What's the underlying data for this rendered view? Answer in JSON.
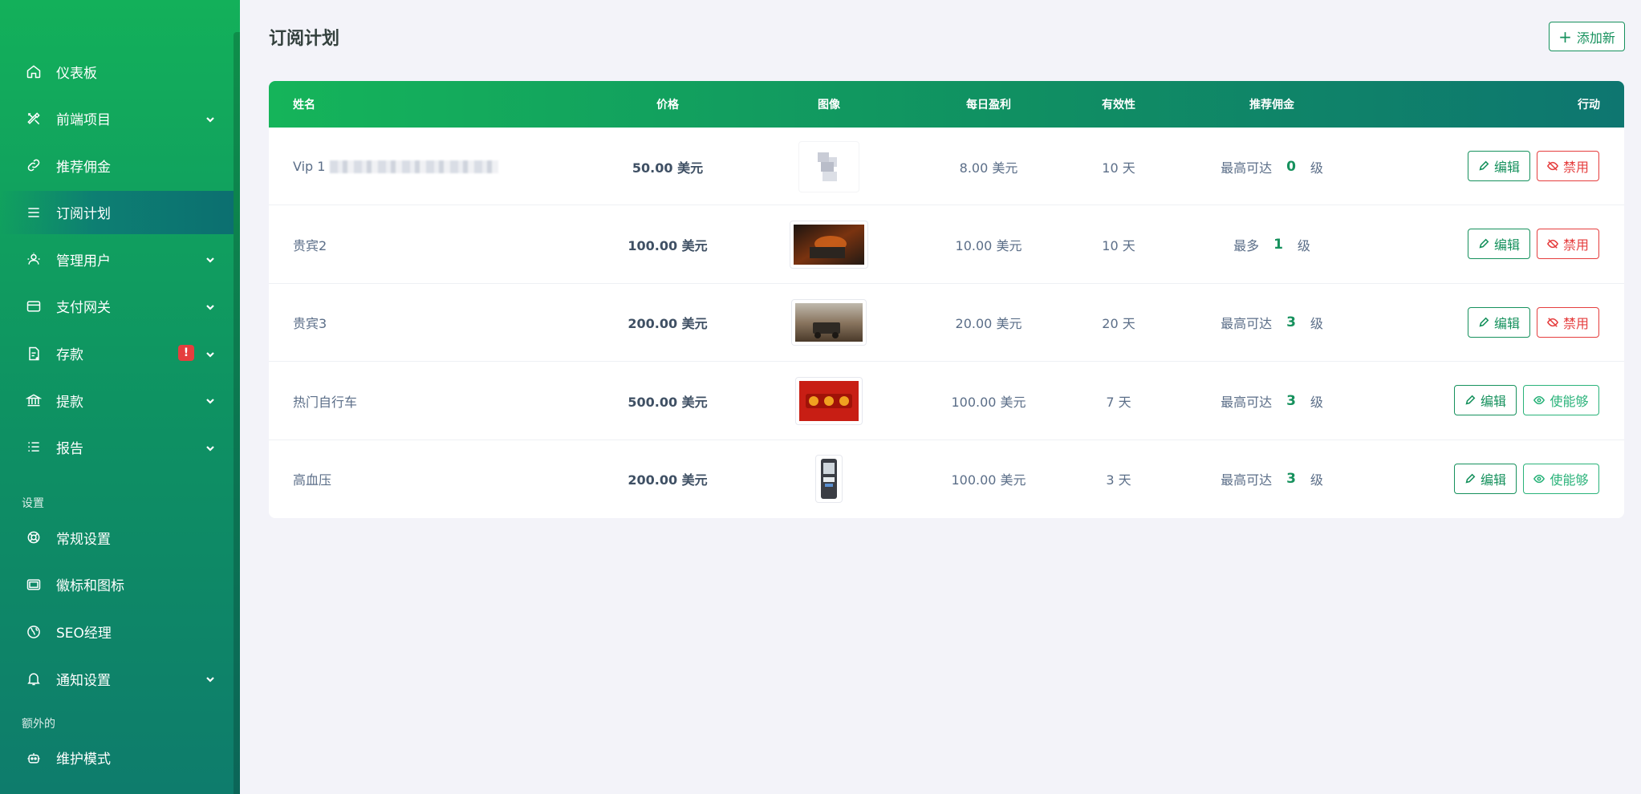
{
  "sidebar": {
    "items": [
      {
        "label": "仪表板",
        "icon": "home-icon"
      },
      {
        "label": "前端项目",
        "icon": "tools-icon"
      },
      {
        "label": "推荐佣金",
        "icon": "link-icon"
      },
      {
        "label": "订阅计划",
        "icon": "menu-icon"
      },
      {
        "label": "管理用户",
        "icon": "users-icon"
      },
      {
        "label": "支付网关",
        "icon": "card-icon"
      },
      {
        "label": "存款",
        "icon": "deposit-icon",
        "alert": "!"
      },
      {
        "label": "提款",
        "icon": "bank-icon"
      },
      {
        "label": "报告",
        "icon": "list-icon"
      }
    ],
    "section_settings": "设置",
    "settings_items": [
      {
        "label": "常规设置",
        "icon": "lifebuoy-icon"
      },
      {
        "label": "徽标和图标",
        "icon": "image-icon"
      },
      {
        "label": "SEO经理",
        "icon": "globe-icon"
      },
      {
        "label": "通知设置",
        "icon": "bell-icon"
      }
    ],
    "section_extra": "额外的",
    "extra_items": [
      {
        "label": "维护模式",
        "icon": "robot-icon"
      }
    ]
  },
  "page": {
    "title": "订阅计划",
    "add_new_label": "添加新"
  },
  "table": {
    "headers": {
      "name": "姓名",
      "price": "价格",
      "image": "图像",
      "daily_profit": "每日盈利",
      "validity": "有效性",
      "referral": "推荐佣金",
      "action": "行动"
    },
    "rows": [
      {
        "name": "Vip 1",
        "price": "50.00 美元",
        "profit": "8.00 美元",
        "validity": "10 天",
        "ref_prefix": "最高可达",
        "ref_level": "0",
        "ref_suffix": "级",
        "edit": "编辑",
        "toggle": "禁用",
        "toggle_type": "disable"
      },
      {
        "name": "贵宾2",
        "price": "100.00 美元",
        "profit": "10.00 美元",
        "validity": "10 天",
        "ref_prefix": "最多",
        "ref_level": "1",
        "ref_suffix": "级",
        "edit": "编辑",
        "toggle": "禁用",
        "toggle_type": "disable"
      },
      {
        "name": "贵宾3",
        "price": "200.00 美元",
        "profit": "20.00 美元",
        "validity": "20 天",
        "ref_prefix": "最高可达",
        "ref_level": "3",
        "ref_suffix": "级",
        "edit": "编辑",
        "toggle": "禁用",
        "toggle_type": "disable"
      },
      {
        "name": "热门自行车",
        "price": "500.00 美元",
        "profit": "100.00 美元",
        "validity": "7 天",
        "ref_prefix": "最高可达",
        "ref_level": "3",
        "ref_suffix": "级",
        "edit": "编辑",
        "toggle": "使能够",
        "toggle_type": "enable"
      },
      {
        "name": "高血压",
        "price": "200.00 美元",
        "profit": "100.00 美元",
        "validity": "3 天",
        "ref_prefix": "最高可达",
        "ref_level": "3",
        "ref_suffix": "级",
        "edit": "编辑",
        "toggle": "使能够",
        "toggle_type": "enable"
      }
    ]
  },
  "colors": {
    "brand_green": "#16915d",
    "danger_red": "#e53e3e",
    "enable_green": "#2ab37a"
  }
}
